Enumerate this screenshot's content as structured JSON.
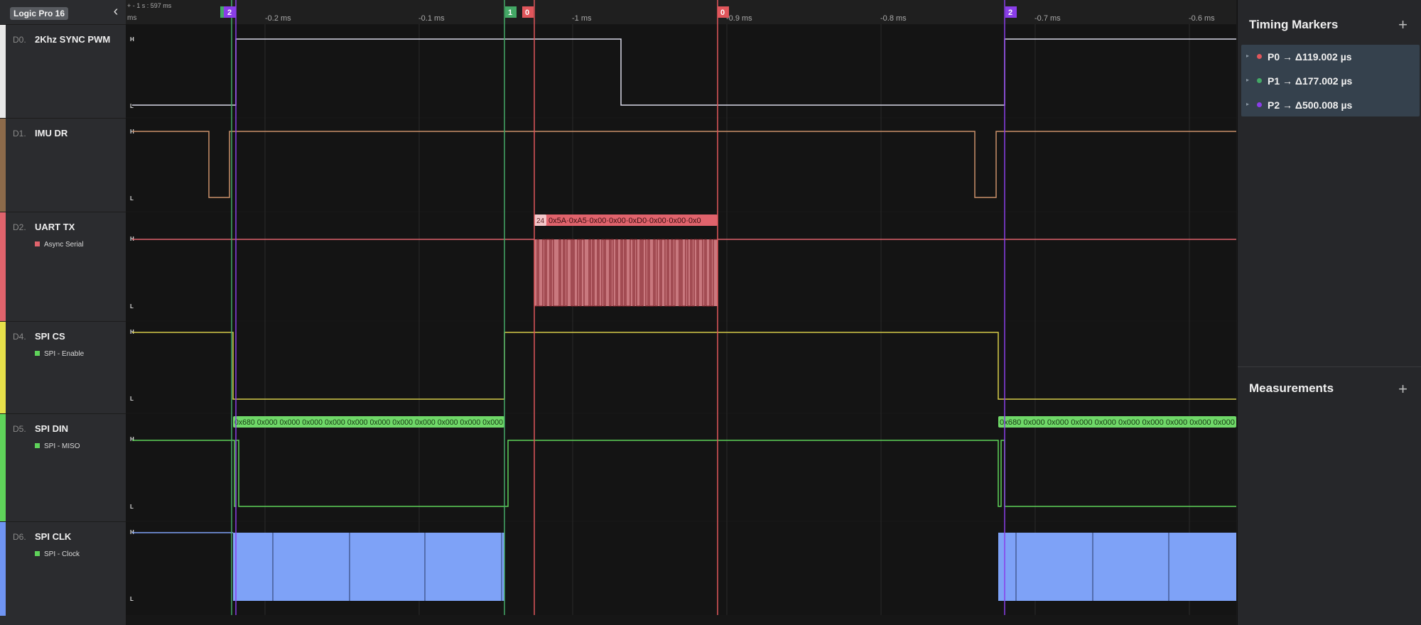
{
  "app": {
    "name": "Logic Pro 16",
    "collapse_icon": "chevron-left-icon"
  },
  "time_ruler": {
    "cursor_info": "+ - 1 s : 597 ms",
    "left_unit": "ms",
    "ticks": [
      {
        "label": "-0.2 ms"
      },
      {
        "label": "-0.1 ms"
      },
      {
        "label": "-1 ms"
      },
      {
        "label": "-0.9 ms"
      },
      {
        "label": "-0.8 ms"
      },
      {
        "label": "-0.7 ms"
      },
      {
        "label": "-0.6 ms"
      }
    ]
  },
  "level_labels": {
    "high": "H",
    "low": "L"
  },
  "marker_flags": [
    {
      "label": "2",
      "color": "#8a3ee8"
    },
    {
      "label": "1",
      "color": "#44a866"
    },
    {
      "label": "0",
      "color": "#e0565b"
    },
    {
      "label": "0",
      "color": "#e0565b"
    },
    {
      "label": "2",
      "color": "#8a3ee8"
    }
  ],
  "channels": [
    {
      "index": "D0.",
      "name": "2Khz SYNC PWM",
      "color": "#e8e8e8",
      "analyzer": "",
      "analyzer_color": ""
    },
    {
      "index": "D1.",
      "name": "IMU DR",
      "color": "#8c6a4a",
      "analyzer": "",
      "analyzer_color": ""
    },
    {
      "index": "D2.",
      "name": "UART TX",
      "color": "#e0636c",
      "analyzer": "Async Serial",
      "analyzer_color": "#e0636c"
    },
    {
      "index": "D4.",
      "name": "SPI CS",
      "color": "#e6e04a",
      "analyzer": "SPI - Enable",
      "analyzer_color": "#5fd35a"
    },
    {
      "index": "D5.",
      "name": "SPI DIN",
      "color": "#5fd35a",
      "analyzer": "SPI - MISO",
      "analyzer_color": "#5fd35a"
    },
    {
      "index": "D6.",
      "name": "SPI CLK",
      "color": "#6f94f2",
      "analyzer": "SPI - Clock",
      "analyzer_color": "#5fd35a"
    }
  ],
  "decodes": {
    "uart": {
      "badge": "24",
      "text": "0x5A·0xA5·0x00·0x00·0xD0·0x00·0x00·0x0"
    },
    "spi_din_first": "0x680 0x000 0x000 0x000 0x000 0x000 0x000 0x000 0x000 0x000 0x000 0x000",
    "spi_din_second": "0x680 0x000 0x000 0x000 0x000 0x000 0x000 0x000 0x000 0x000"
  },
  "colors": {
    "sync": "#d8d8e8",
    "imu": "#c9906a",
    "uart": "#e0636c",
    "spi_cs": "#d6cc4a",
    "spi_din": "#5fd35a",
    "spi_clk": "#7ea2f7",
    "marker_p0": "#e0565b",
    "marker_p1": "#44a866",
    "marker_p2": "#8a3ee8"
  },
  "timing_markers": {
    "title": "Timing Markers",
    "add_icon": "plus-icon",
    "items": [
      {
        "label": "P0 → Δ119.002 µs",
        "color": "#e0565b"
      },
      {
        "label": "P1 → Δ177.002 µs",
        "color": "#44a866"
      },
      {
        "label": "P2 → Δ500.008 µs",
        "color": "#8a3ee8"
      }
    ]
  },
  "measurements": {
    "title": "Measurements",
    "add_icon": "plus-icon"
  }
}
